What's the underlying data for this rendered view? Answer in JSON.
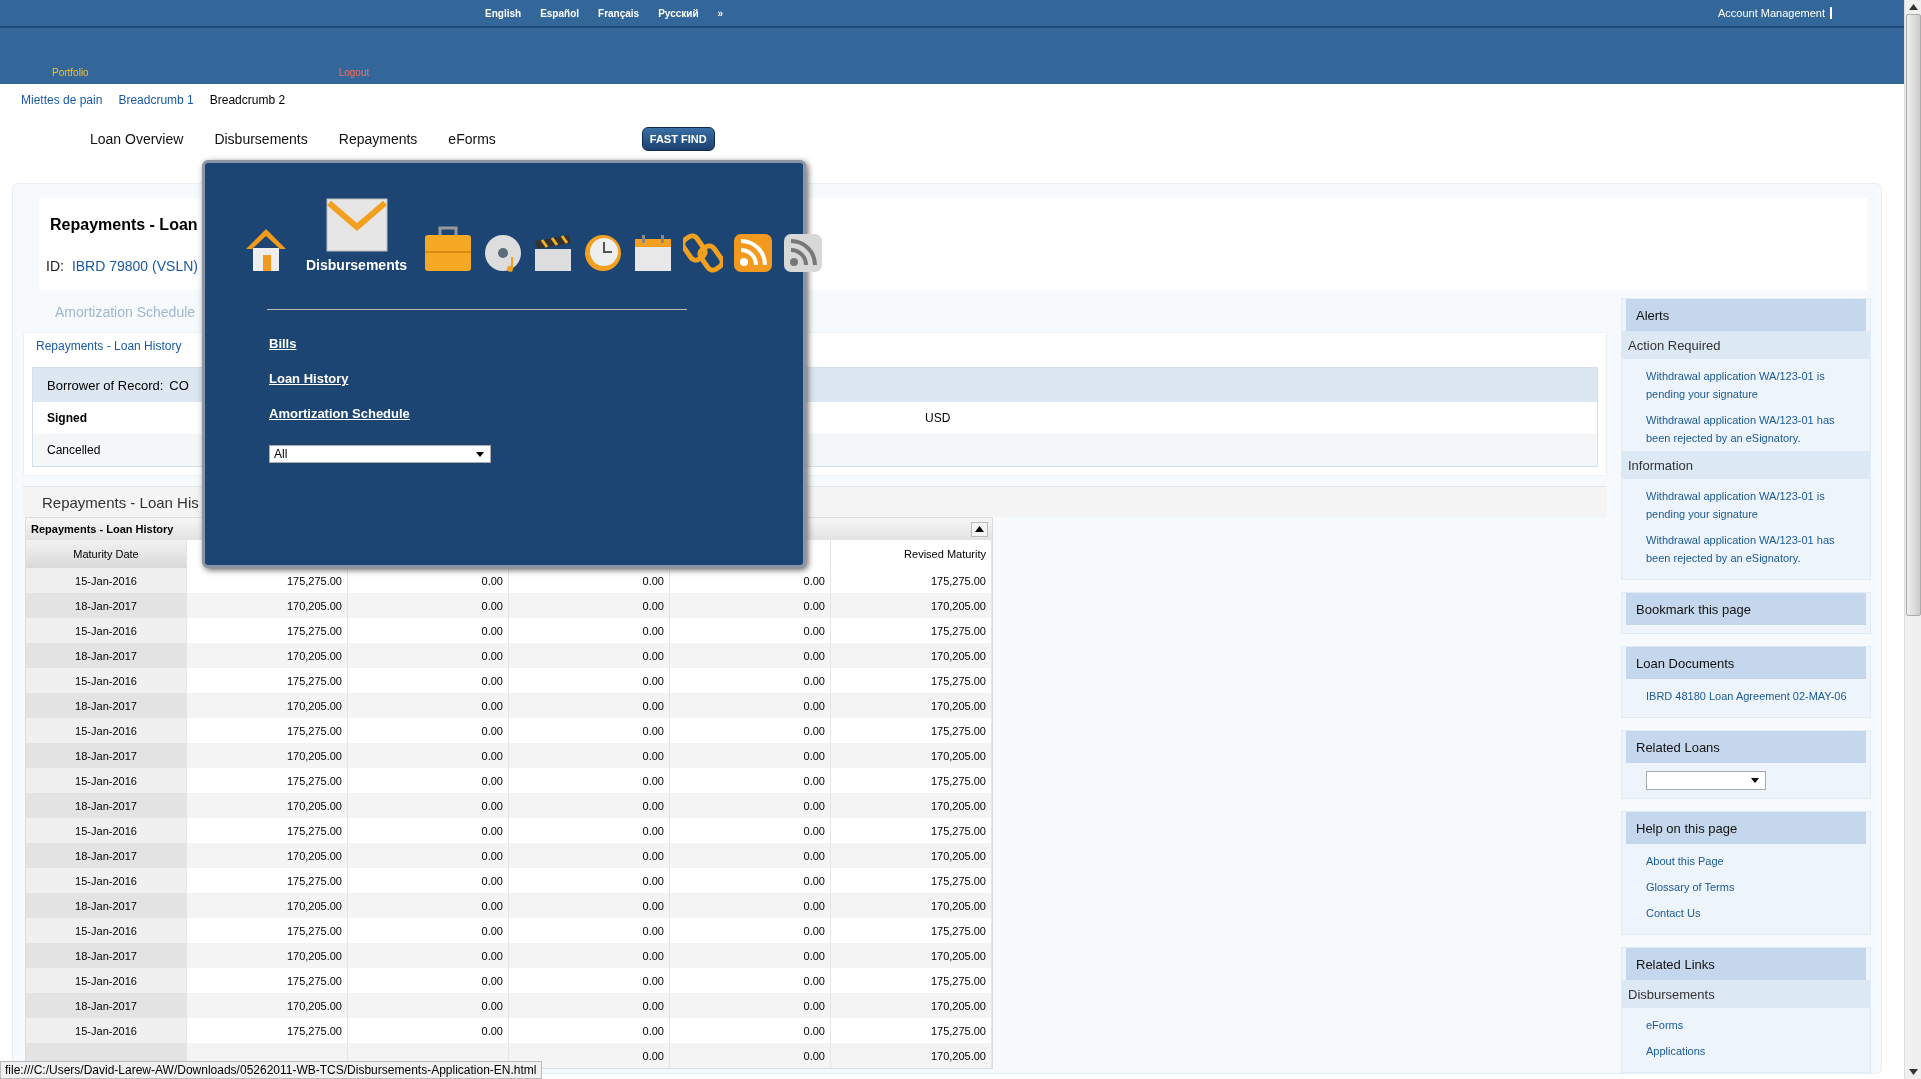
{
  "top_bar": {
    "languages": [
      "English",
      "Español",
      "Français",
      "Русский"
    ],
    "more": "»",
    "account": "Account Management",
    "portfolio": "Portfolio",
    "logout": "Logout"
  },
  "breadcrumb": [
    {
      "label": "Miettes de pain",
      "link": true
    },
    {
      "label": "Breadcrumb 1",
      "link": true
    },
    {
      "label": "Breadcrumb 2",
      "link": false
    }
  ],
  "nav": {
    "items": [
      "Loan Overview",
      "Disbursements",
      "Repayments",
      "eForms"
    ],
    "fast_find": "FAST FIND"
  },
  "header": {
    "title": "Repayments - Loan",
    "id_label": "ID:",
    "id": "IBRD 79800 (VSLN)"
  },
  "subtabs": [
    "Amortization Schedule"
  ],
  "section_link": "Repayments - Loan History",
  "borrower": {
    "label": "Borrower of Record:",
    "value": "CO",
    "rows": [
      {
        "label": "Signed",
        "extra_value": "USD",
        "bold": true
      },
      {
        "label": "Cancelled",
        "bold": false
      }
    ]
  },
  "section_title": "Repayments - Loan His",
  "table": {
    "title": "Repayments - Loan History",
    "columns": [
      "Maturity Date",
      null,
      null,
      null,
      null,
      "Revised Maturity"
    ],
    "rows": [
      [
        "15-Jan-2016",
        "175,275.00",
        "0.00",
        "0.00",
        "0.00",
        "175,275.00"
      ],
      [
        "18-Jan-2017",
        "170,205.00",
        "0.00",
        "0.00",
        "0.00",
        "170,205.00"
      ],
      [
        "15-Jan-2016",
        "175,275.00",
        "0.00",
        "0.00",
        "0.00",
        "175,275.00"
      ],
      [
        "18-Jan-2017",
        "170,205.00",
        "0.00",
        "0.00",
        "0.00",
        "170,205.00"
      ],
      [
        "15-Jan-2016",
        "175,275.00",
        "0.00",
        "0.00",
        "0.00",
        "175,275.00"
      ],
      [
        "18-Jan-2017",
        "170,205.00",
        "0.00",
        "0.00",
        "0.00",
        "170,205.00"
      ],
      [
        "15-Jan-2016",
        "175,275.00",
        "0.00",
        "0.00",
        "0.00",
        "175,275.00"
      ],
      [
        "18-Jan-2017",
        "170,205.00",
        "0.00",
        "0.00",
        "0.00",
        "170,205.00"
      ],
      [
        "15-Jan-2016",
        "175,275.00",
        "0.00",
        "0.00",
        "0.00",
        "175,275.00"
      ],
      [
        "18-Jan-2017",
        "170,205.00",
        "0.00",
        "0.00",
        "0.00",
        "170,205.00"
      ],
      [
        "15-Jan-2016",
        "175,275.00",
        "0.00",
        "0.00",
        "0.00",
        "175,275.00"
      ],
      [
        "18-Jan-2017",
        "170,205.00",
        "0.00",
        "0.00",
        "0.00",
        "170,205.00"
      ],
      [
        "15-Jan-2016",
        "175,275.00",
        "0.00",
        "0.00",
        "0.00",
        "175,275.00"
      ],
      [
        "18-Jan-2017",
        "170,205.00",
        "0.00",
        "0.00",
        "0.00",
        "170,205.00"
      ],
      [
        "15-Jan-2016",
        "175,275.00",
        "0.00",
        "0.00",
        "0.00",
        "175,275.00"
      ],
      [
        "18-Jan-2017",
        "170,205.00",
        "0.00",
        "0.00",
        "0.00",
        "170,205.00"
      ],
      [
        "15-Jan-2016",
        "175,275.00",
        "0.00",
        "0.00",
        "0.00",
        "175,275.00"
      ],
      [
        "18-Jan-2017",
        "170,205.00",
        "0.00",
        "0.00",
        "0.00",
        "170,205.00"
      ],
      [
        "15-Jan-2016",
        "175,275.00",
        "0.00",
        "0.00",
        "0.00",
        "175,275.00"
      ],
      [
        "",
        "",
        "",
        "0.00",
        "0.00",
        "170,205.00"
      ]
    ]
  },
  "popup": {
    "icons": [
      {
        "kind": "home",
        "selected": false
      },
      {
        "kind": "mail",
        "selected": true,
        "label": "Disbursements"
      },
      {
        "kind": "briefcase",
        "selected": false
      },
      {
        "kind": "disc",
        "selected": false
      },
      {
        "kind": "clapper",
        "selected": false
      },
      {
        "kind": "clock",
        "selected": false
      },
      {
        "kind": "calendar",
        "selected": false
      },
      {
        "kind": "link",
        "selected": false
      },
      {
        "kind": "feed",
        "selected": false
      },
      {
        "kind": "feedgrey",
        "selected": false
      }
    ],
    "links": [
      "Bills",
      "Loan History",
      "Amortization Schedule"
    ],
    "select": "All"
  },
  "sidebar": [
    {
      "title": "Alerts",
      "groups": [
        {
          "title": "Action Required",
          "links": [
            "Withdrawal application WA/123-01 is pending your signature",
            "Withdrawal application WA/123-01 has been rejected by an eSignatory."
          ]
        },
        {
          "title": "Information",
          "links": [
            "Withdrawal application WA/123-01 is pending your signature",
            "Withdrawal application WA/123-01 has been rejected by an eSignatory."
          ]
        }
      ]
    },
    {
      "title": "Bookmark this page"
    },
    {
      "title": "Loan Documents",
      "groups": [
        {
          "links": [
            "IBRD 48180 Loan Agreement 02-MAY-06"
          ]
        }
      ]
    },
    {
      "title": "Related Loans",
      "kind": "select"
    },
    {
      "title": "Help on this page",
      "groups": [
        {
          "links": [
            "About this Page",
            "Glossary of Terms",
            "Contact Us"
          ]
        }
      ]
    },
    {
      "title": "Related Links",
      "groups": [
        {
          "title": "Disbursements",
          "links": [
            "eForms",
            "Applications"
          ]
        }
      ]
    }
  ],
  "status_url": "file:///C:/Users/David-Larew-AW/Downloads/05262011-WB-TCS/Disbursements-Application-EN.html"
}
